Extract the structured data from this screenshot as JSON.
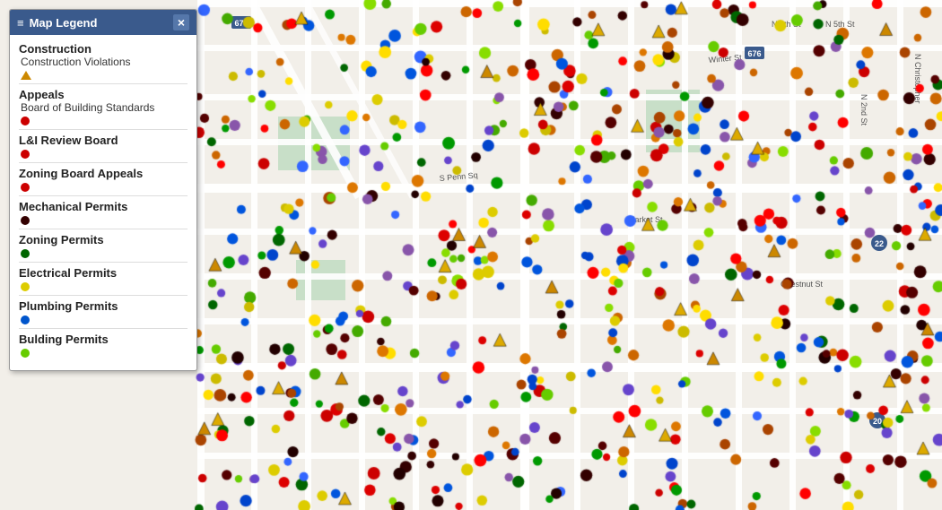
{
  "legend": {
    "title": "Map Legend",
    "close_label": "×",
    "hamburger": "≡",
    "categories": [
      {
        "id": "construction",
        "title": "Construction",
        "items": [
          {
            "label": "Construction Violations",
            "shape": "triangle",
            "color": "#cc8800"
          }
        ]
      },
      {
        "id": "appeals",
        "title": "Appeals",
        "items": [
          {
            "label": "Board of Building Standards",
            "shape": "dot",
            "color": "#cc0000"
          }
        ]
      },
      {
        "id": "li-review",
        "title": "L&I Review Board",
        "items": [
          {
            "label": "",
            "shape": "dot",
            "color": "#cc0000"
          }
        ]
      },
      {
        "id": "zoning-board",
        "title": "Zoning Board Appeals",
        "items": [
          {
            "label": "",
            "shape": "dot",
            "color": "#cc0000"
          }
        ]
      },
      {
        "id": "mechanical",
        "title": "Mechanical Permits",
        "items": [
          {
            "label": "",
            "shape": "dot",
            "color": "#330000"
          }
        ]
      },
      {
        "id": "zoning-permits",
        "title": "Zoning Permits",
        "items": [
          {
            "label": "",
            "shape": "dot",
            "color": "#006600"
          }
        ]
      },
      {
        "id": "electrical",
        "title": "Electrical Permits",
        "items": [
          {
            "label": "",
            "shape": "dot",
            "color": "#ddcc00"
          }
        ]
      },
      {
        "id": "plumbing",
        "title": "Plumbing Permits",
        "items": [
          {
            "label": "",
            "shape": "dot",
            "color": "#0055cc"
          }
        ]
      },
      {
        "id": "building",
        "title": "Bulding Permits",
        "items": [
          {
            "label": "",
            "shape": "dot",
            "color": "#66cc00"
          }
        ]
      }
    ]
  },
  "map": {
    "bg_color": "#f2efe9",
    "road_color": "#ffffff",
    "park_color": "#c8dfc8"
  }
}
